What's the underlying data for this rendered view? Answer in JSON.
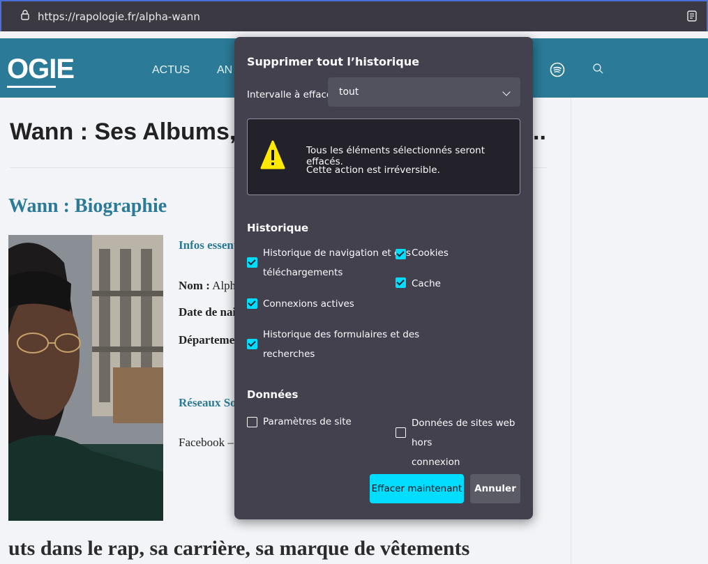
{
  "browser": {
    "url": "https://rapologie.fr/alpha-wann"
  },
  "site": {
    "logo": "OGIE",
    "nav": [
      "ACTUS",
      "AN"
    ]
  },
  "article": {
    "title": "Wann : Ses Albums,",
    "title_tail": "..",
    "bio_heading": "Wann : Biographie",
    "infos_label": "Infos essent",
    "nom_label": "Nom :",
    "nom_value": "Alph",
    "date_label": "Date de nai",
    "dept_label": "Départeme",
    "reseaux_label": "Réseaux So",
    "facebook": "Facebook –",
    "bottom_heading": "uts dans le rap, sa carrière, sa marque de vêtements"
  },
  "dialog": {
    "title": "Supprimer tout l’historique",
    "range_label": "Intervalle à effacer :",
    "range_value": "tout",
    "warning_line1": "Tous les éléments sélectionnés seront effacés.",
    "warning_line2": "Cette action est irréversible.",
    "history_heading": "Historique",
    "data_heading": "Données",
    "options": {
      "browsing_l1": "Historique de navigation et des",
      "browsing_l2": "téléchargements",
      "cookies": "Cookies",
      "cache": "Cache",
      "connections": "Connexions actives",
      "forms_l1": "Historique des formulaires et des",
      "forms_l2": "recherches",
      "site_settings": "Paramètres de site",
      "offline_l1": "Données de sites web hors",
      "offline_l2": "connexion"
    },
    "checked": {
      "browsing": true,
      "cookies": true,
      "cache": true,
      "connections": true,
      "forms": true,
      "site_settings": false,
      "offline": false
    },
    "clear_button": "Effacer maintenant",
    "cancel_button": "Annuler"
  },
  "colors": {
    "accent": "#00ddff",
    "dialog_bg": "#42414d",
    "site_blue": "#2b7a97"
  }
}
